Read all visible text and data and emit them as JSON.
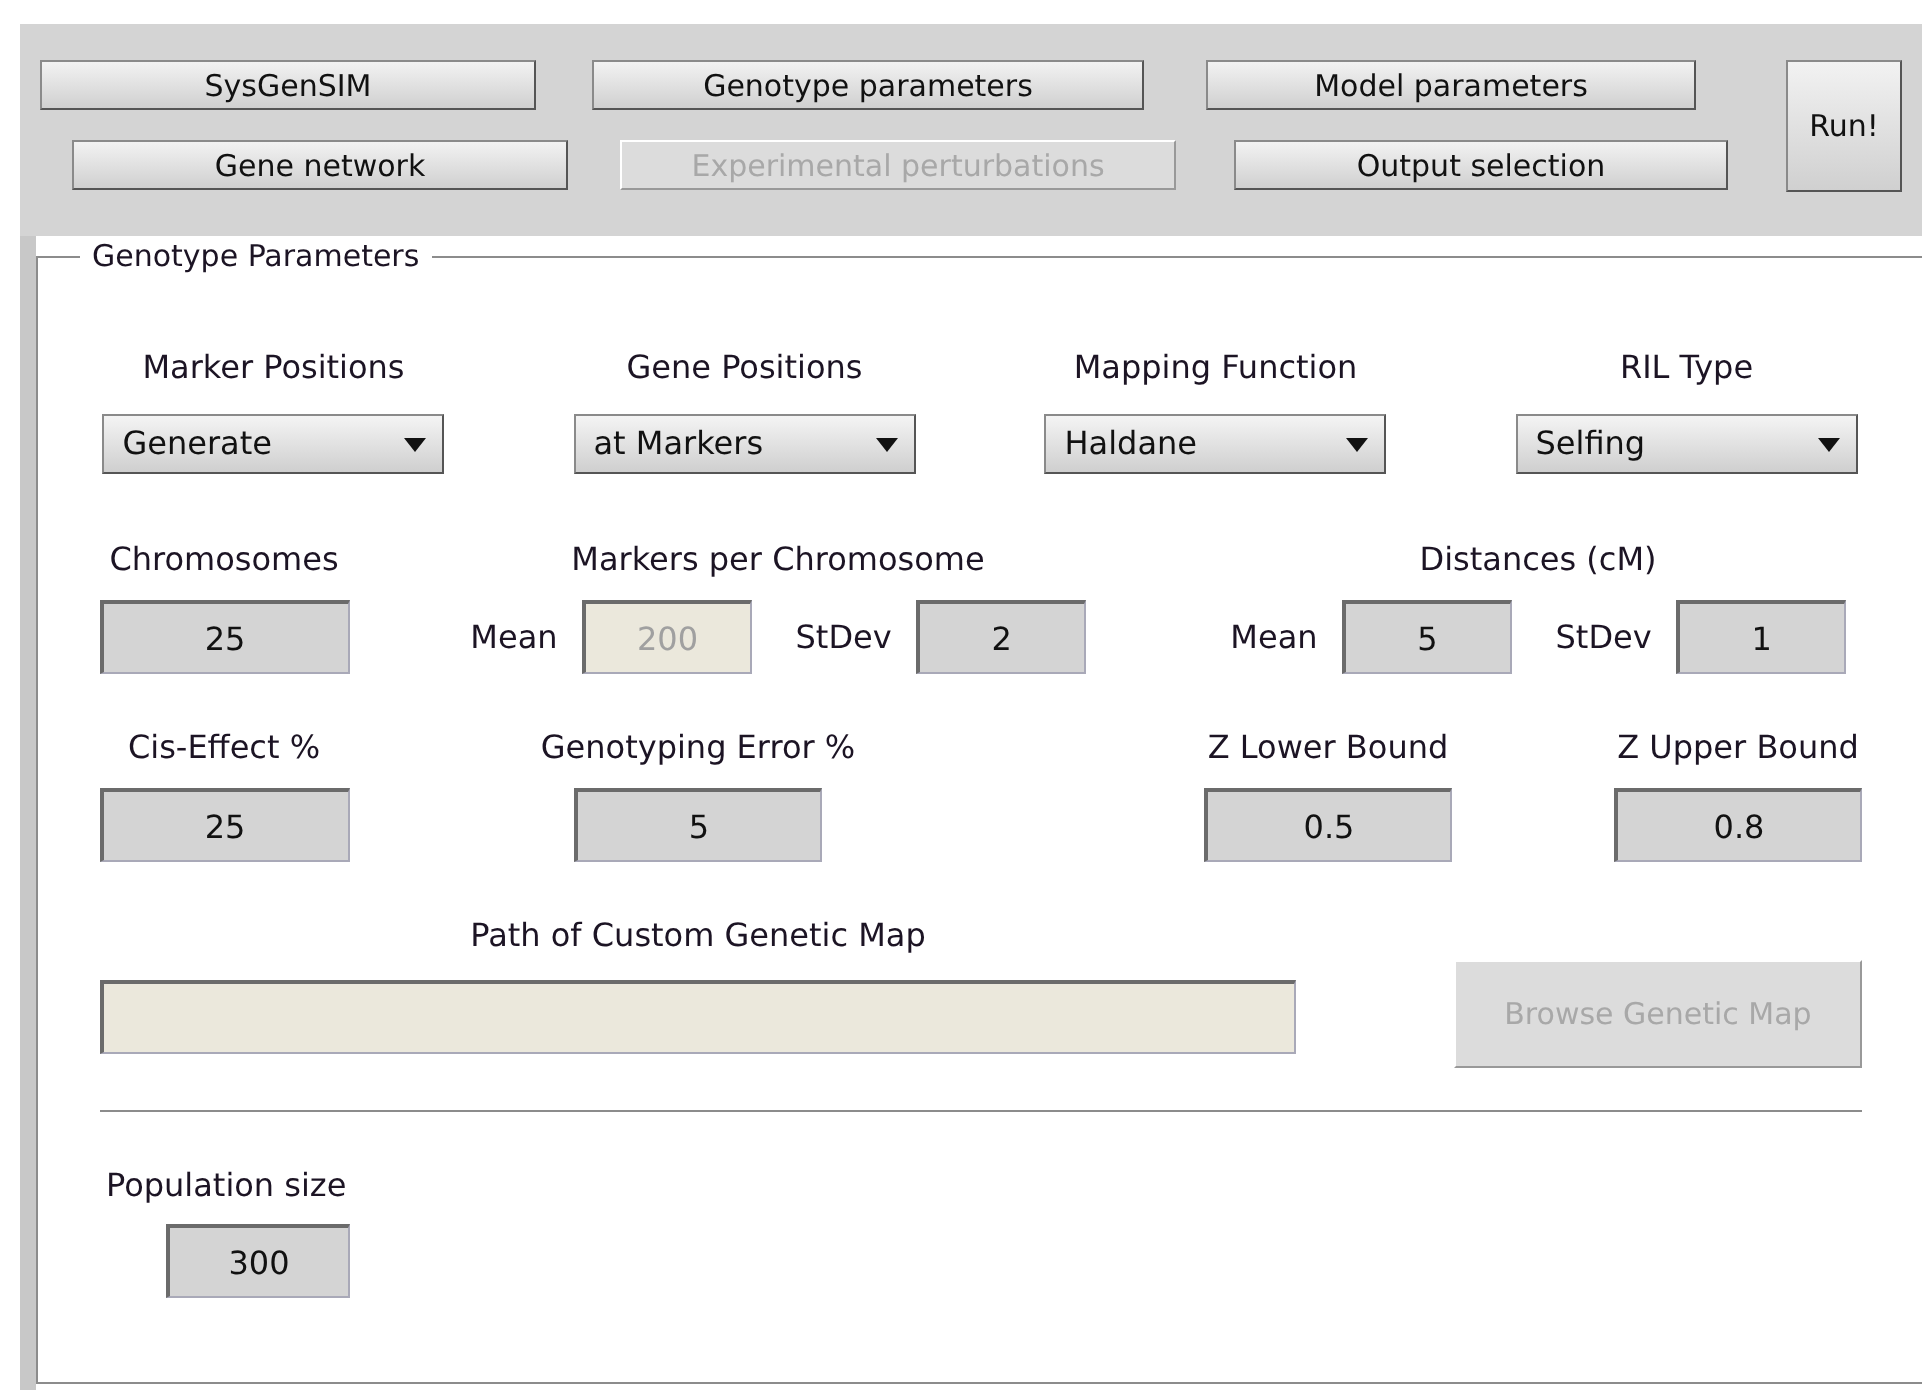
{
  "nav_buttons": [
    {
      "label": "SysGenSIM",
      "disabled": false
    },
    {
      "label": "Genotype parameters",
      "disabled": false
    },
    {
      "label": "Model parameters",
      "disabled": false
    },
    {
      "label": "Gene network",
      "disabled": false
    },
    {
      "label": "Experimental perturbations",
      "disabled": true
    },
    {
      "label": "Output selection",
      "disabled": false
    }
  ],
  "run_button": {
    "label": "Run!"
  },
  "panel": {
    "title": "Genotype Parameters",
    "dropdowns": [
      {
        "label": "Marker Positions",
        "value": "Generate"
      },
      {
        "label": "Gene Positions",
        "value": "at Markers"
      },
      {
        "label": "Mapping Function",
        "value": "Haldane"
      },
      {
        "label": "RIL Type",
        "value": "Selfing"
      }
    ],
    "chromosomes": {
      "label": "Chromosomes",
      "value": "25"
    },
    "markers_per_chromosome": {
      "label": "Markers per Chromosome",
      "mean_label": "Mean",
      "mean": {
        "value": "200",
        "disabled": true
      },
      "stdev_label": "StDev",
      "stdev": {
        "value": "2",
        "disabled": false
      }
    },
    "distances": {
      "label": "Distances (cM)",
      "mean_label": "Mean",
      "mean": {
        "value": "5",
        "disabled": false
      },
      "stdev_label": "StDev",
      "stdev": {
        "value": "1",
        "disabled": false
      }
    },
    "cis_effect": {
      "label": "Cis-Effect %",
      "value": "25"
    },
    "genotyping_error": {
      "label": "Genotyping Error %",
      "value": "5"
    },
    "z_lower_bound": {
      "label": "Z Lower Bound",
      "value": "0.5"
    },
    "z_upper_bound": {
      "label": "Z Upper Bound",
      "value": "0.8"
    },
    "custom_map": {
      "label": "Path of Custom Genetic Map",
      "disabled": true
    },
    "browse_button": {
      "label": "Browse Genetic Map",
      "disabled": true
    },
    "population_size": {
      "label": "Population size",
      "value": "300"
    }
  }
}
